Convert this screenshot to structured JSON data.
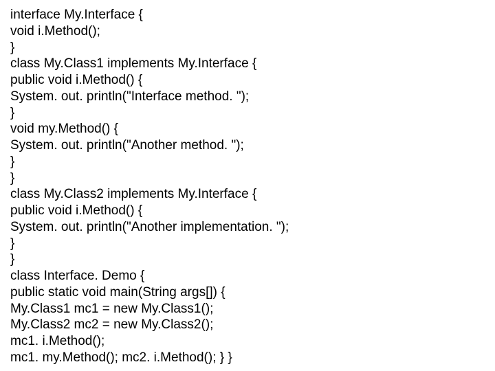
{
  "code": {
    "lines": [
      "interface My.Interface {",
      "void i.Method();",
      "}",
      "class My.Class1 implements My.Interface {",
      "public void i.Method() {",
      "System. out. println(\"Interface method. \");",
      "}",
      "void my.Method() {",
      "System. out. println(\"Another method. \");",
      "}",
      "}",
      "class My.Class2 implements My.Interface {",
      "public void i.Method() {",
      "System. out. println(\"Another implementation. \");",
      "}",
      "}",
      "class Interface. Demo {",
      "public static void main(String args[]) {",
      "My.Class1 mc1 = new My.Class1();",
      "My.Class2 mc2 = new My.Class2();",
      "mc1. i.Method();",
      "mc1. my.Method(); mc2. i.Method(); } }"
    ]
  }
}
